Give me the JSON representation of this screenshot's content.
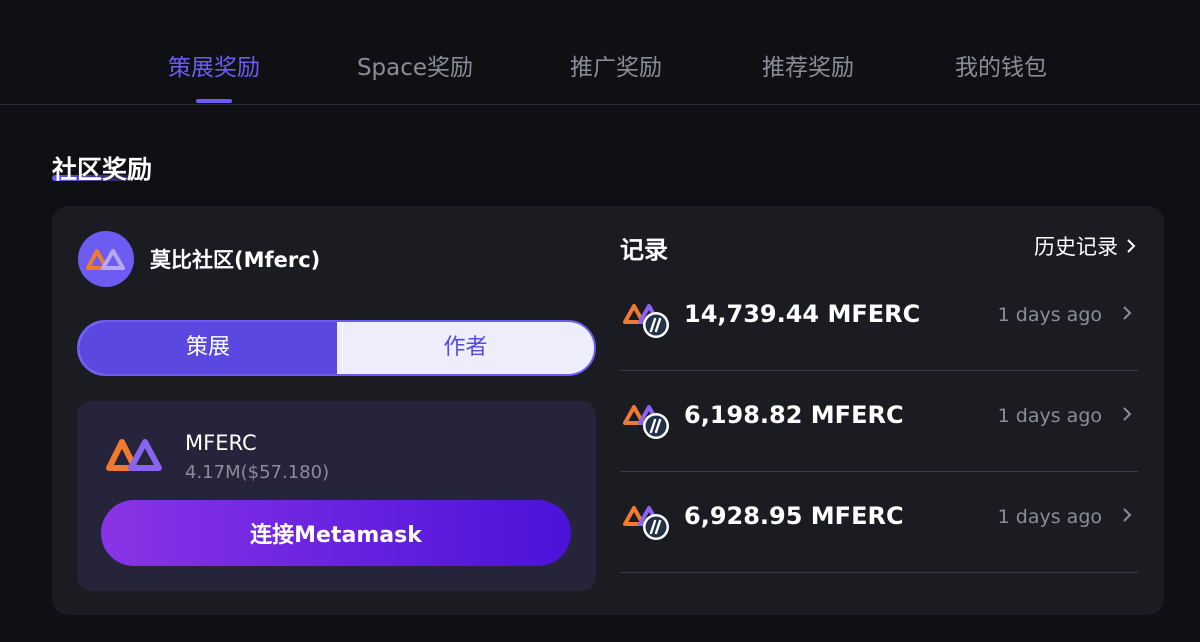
{
  "tabs": [
    {
      "label": "策展奖励",
      "active": true
    },
    {
      "label": "Space奖励",
      "active": false
    },
    {
      "label": "推广奖励",
      "active": false
    },
    {
      "label": "推荐奖励",
      "active": false
    },
    {
      "label": "我的钱包",
      "active": false
    }
  ],
  "section": {
    "title": "社区奖励"
  },
  "community": {
    "name": "莫比社区(Mferc)"
  },
  "toggle": {
    "left_label": "策展",
    "right_label": "作者",
    "selected": "策展"
  },
  "wallet": {
    "token_name": "MFERC",
    "token_amount": "4.17M($57.180)",
    "connect_label": "连接Metamask"
  },
  "records": {
    "title": "记录",
    "history_label": "历史记录",
    "items": [
      {
        "amount": "14,739.44 MFERC",
        "time": "1 days ago"
      },
      {
        "amount": "6,198.82 MFERC",
        "time": "1 days ago"
      },
      {
        "amount": "6,928.95 MFERC",
        "time": "1 days ago"
      }
    ]
  },
  "colors": {
    "accent": "#6d5cf2",
    "background": "#0f1014",
    "card": "#1b1c22",
    "logo_orange": "#f07a2e",
    "logo_purple": "#8a63f0"
  },
  "icons": [
    "mferc-logo-icon",
    "arbitrum-icon",
    "chevron-right-icon"
  ]
}
